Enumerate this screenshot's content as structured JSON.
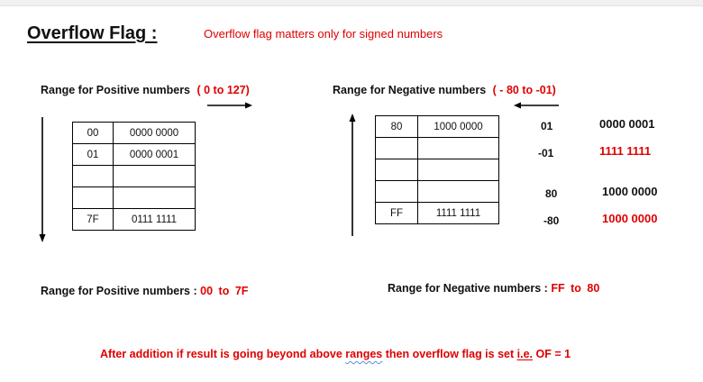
{
  "title": "Overflow Flag :",
  "note": "Overflow flag matters only for signed numbers",
  "positive": {
    "range_label": "Range for Positive numbers",
    "range_value": "( 0 to 127)",
    "rows": [
      {
        "hex": "00",
        "bin": "0000 0000"
      },
      {
        "hex": "01",
        "bin": "0000 0001"
      },
      {
        "hex": "",
        "bin": ""
      },
      {
        "hex": "",
        "bin": ""
      },
      {
        "hex": "7F",
        "bin": "0111 1111"
      }
    ],
    "bottom_label": "Range for Positive numbers :",
    "bottom_from": "00",
    "bottom_to_word": "to",
    "bottom_to": "7F"
  },
  "negative": {
    "range_label": "Range for Negative numbers",
    "range_value": "( - 80 to -01)",
    "rows": [
      {
        "hex": "80",
        "bin": "1000 0000"
      },
      {
        "hex": "",
        "bin": ""
      },
      {
        "hex": "",
        "bin": ""
      },
      {
        "hex": "",
        "bin": ""
      },
      {
        "hex": "FF",
        "bin": "1111 1111"
      }
    ],
    "bottom_label": "Range for Negative numbers :",
    "bottom_from": "FF",
    "bottom_to_word": "to",
    "bottom_to": "80"
  },
  "examples": [
    {
      "dec": "01",
      "bin": "0000  0001",
      "bin_color": "#000000"
    },
    {
      "dec": "-01",
      "bin": "1111  1111",
      "bin_color": "#e00000"
    },
    {
      "dec": "80",
      "bin": "1000  0000",
      "bin_color": "#000000"
    },
    {
      "dec": "-80",
      "bin": "1000  0000",
      "bin_color": "#e00000"
    }
  ],
  "conclusion": {
    "part1": "After addition if result is going beyond above",
    "word_ranges": "ranges",
    "part2": "then overflow flag is set",
    "word_ie": "i.e.",
    "part3": "OF = 1"
  },
  "colors": {
    "accent_red": "#e00000",
    "text": "#111111"
  }
}
